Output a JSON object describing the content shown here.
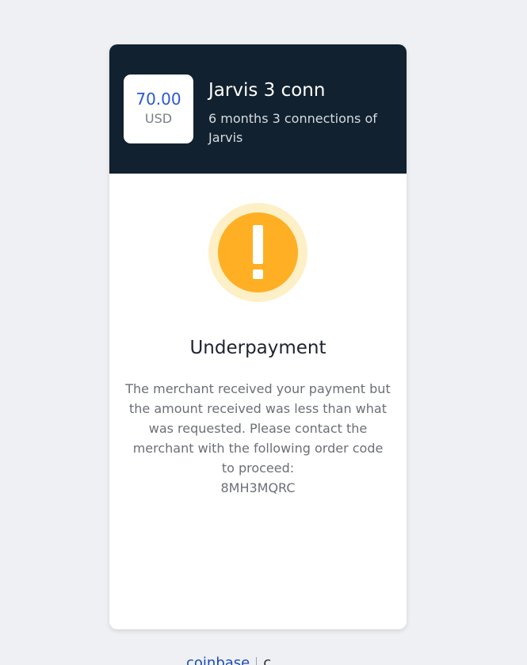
{
  "header": {
    "price_amount": "70.00",
    "price_currency": "USD",
    "product_title": "Jarvis 3 conn",
    "product_description": "6 months 3 connections of Jarvis"
  },
  "status": {
    "icon": "exclamation-icon",
    "title": "Underpayment",
    "message": "The merchant received your payment but the amount received was less than what was requested. Please contact the merchant with the following order code to proceed:",
    "order_code": "8MH3MQRC"
  },
  "footer": {
    "brand": "coinbase",
    "extra": "c"
  },
  "colors": {
    "page_background": "#eef0f4",
    "header_background": "#11212f",
    "price_color": "#2a57d6",
    "warning_orange": "#ffaf24",
    "warning_halo": "#fdf0c6",
    "brand_blue": "#1e4bb5"
  }
}
